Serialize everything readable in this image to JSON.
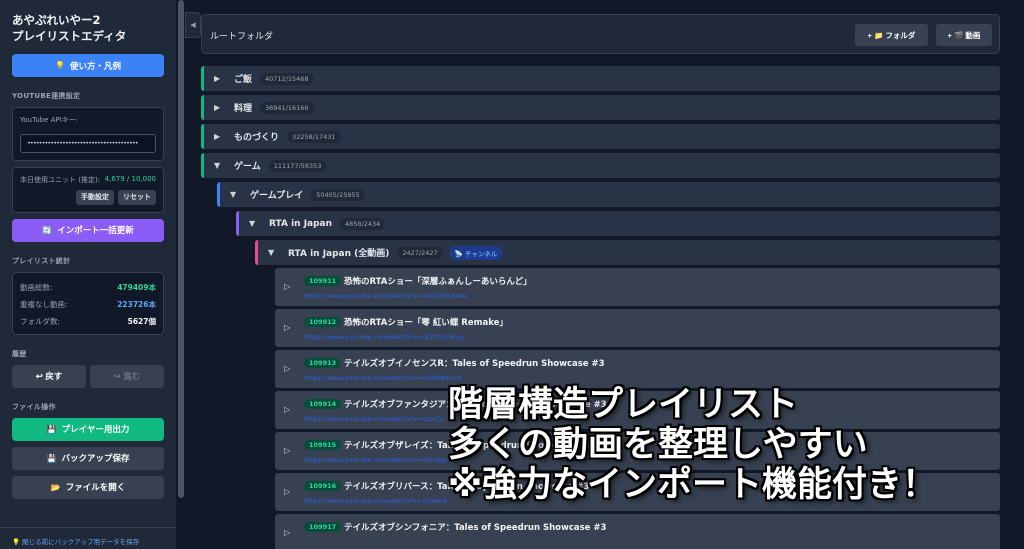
{
  "sidebar": {
    "title_line1": "あやぷれいやー2",
    "title_line2": "プレイリストエディタ",
    "help_icon": "bulb-icon",
    "help_label": "使い方・凡例",
    "youtube_section": "YOUTUBE連携設定",
    "api_key_label": "YouTube APIキー:",
    "api_key_value": "••••••••••••••••••••••••••••••••••••••",
    "units_label": "本日使用ユニット (推定):",
    "units_value": "4,679 / 10,000",
    "manual_set_label": "手動設定",
    "reset_label": "リセット",
    "import_icon": "refresh-icon",
    "import_label": "インポート一括更新",
    "stats_section": "プレイリスト統計",
    "stats": [
      {
        "label": "動画総数:",
        "value": "479409本"
      },
      {
        "label": "重複なし動画:",
        "value": "223726本"
      },
      {
        "label": "フォルダ数:",
        "value": "5627個"
      }
    ],
    "history_section": "履歴",
    "back_label": "↩ 戻す",
    "forward_label": "↪ 進む",
    "file_section": "ファイル操作",
    "player_export_label": "プレイヤー用出力",
    "backup_label": "バックアップ保存",
    "open_file_label": "ファイルを開く",
    "warning_text": "閉じる前にバックアップ用データを保存"
  },
  "topbar": {
    "title": "ルートフォルダ",
    "add_folder_label": "+ 📁 フォルダ",
    "add_video_label": "+ 🎬 動画"
  },
  "collapse_glyph": "◀",
  "folders": [
    {
      "name": "ご飯",
      "count": "40712/15468",
      "expanded": false
    },
    {
      "name": "料理",
      "count": "36941/16166",
      "expanded": false
    },
    {
      "name": "ものづくり",
      "count": "32258/17431",
      "expanded": false
    },
    {
      "name": "ゲーム",
      "count": "111177/58353",
      "expanded": true
    },
    {
      "name": "ゲームプレイ",
      "count": "50405/25955",
      "expanded": true
    },
    {
      "name": "RTA in Japan",
      "count": "4858/2434",
      "expanded": true
    },
    {
      "name": "RTA in Japan (全動画)",
      "count": "2427/2427",
      "expanded": true,
      "badge": "📡 チャンネル"
    }
  ],
  "videos": [
    {
      "id": "109911",
      "title": "恐怖のRTAショー「深層ふぁんしーあいらんど」",
      "url": "https://www.youtube.com/watch?v=WezCNfKSiew"
    },
    {
      "id": "109912",
      "title": "恐怖のRTAショー「零 紅い蝶 Remake」",
      "url": "https://www.youtube.com/watch?v=cEZchCrNiug"
    },
    {
      "id": "109913",
      "title": "テイルズオブイノセンスR：Tales of Speedrun Showcase #3",
      "url": "https://www.youtube.com/watch?v=H3RObdOcK"
    },
    {
      "id": "109914",
      "title": "テイルズオブファンタジア：Tales of Speedrun Showcase #3",
      "url": "https://www.youtube.com/watch?v=uzarCn"
    },
    {
      "id": "109915",
      "title": "テイルズオブザレイズ：Tales of Speedrun Showcase #3",
      "url": "https://www.youtube.com/watch?v=USmlqp"
    },
    {
      "id": "109916",
      "title": "テイルズオブリバース：Tales of Speedrun Showcase #3",
      "url": "https://www.youtube.com/watch?v=yG2eoA"
    },
    {
      "id": "109917",
      "title": "テイルズオブシンフォニア：Tales of Speedrun Showcase #3",
      "url": ""
    }
  ],
  "overlay": {
    "line1": "階層構造プレイリスト",
    "line2": "多くの動画を整理しやすい",
    "line3": "※強力なインポート機能付き！"
  },
  "colors": {
    "accent_green": "#10b981",
    "accent_blue": "#3b82f6",
    "accent_purple": "#8b5cf6",
    "accent_pink": "#ec4899"
  }
}
